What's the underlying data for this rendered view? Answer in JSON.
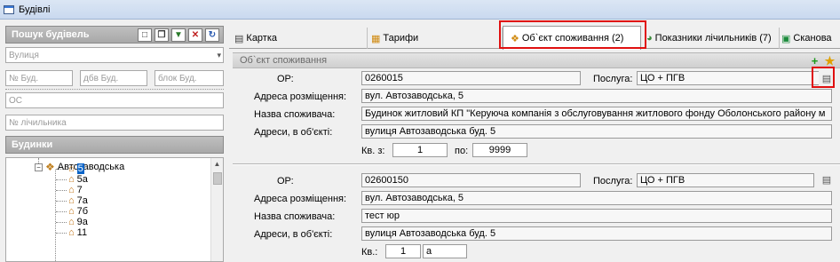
{
  "window": {
    "title": "Будівлі"
  },
  "search": {
    "header": "Пошук будівель",
    "street_placeholder": "Вулиця",
    "building_no_placeholder": "№ Буд.",
    "building_no2_placeholder": "дбв Буд.",
    "block_placeholder": "блок Буд.",
    "os_placeholder": "ОС",
    "meter_placeholder": "№ лічильника"
  },
  "houses": {
    "header": "Будинки",
    "street": "Автозаводська",
    "items": [
      "5",
      "5а",
      "7",
      "7а",
      "7б",
      "9а",
      "11"
    ],
    "selected_index": 0
  },
  "tabs": [
    {
      "label": "Картка"
    },
    {
      "label": "Тарифи"
    },
    {
      "label": "Об`єкт споживання (2)"
    },
    {
      "label": "Показники лічильників (7)"
    },
    {
      "label": "Сканова"
    }
  ],
  "object_section": {
    "header": "Об`єкт споживання",
    "labels": {
      "op": "ОР:",
      "service": "Послуга:",
      "address": "Адреса розміщення:",
      "consumer": "Назва споживача:",
      "obj_addresses": "Адреси, в об'єкті:",
      "apt_from": "Кв. з:",
      "apt_to": "по:",
      "apt": "Кв.:"
    },
    "records": [
      {
        "op": "0260015",
        "service": "ЦО + ПГВ",
        "address": "вул. Автозаводська, 5",
        "consumer": "Будинок житловий КП  \"Керуюча компанія з обслуговування житлового фонду Оболонського району м",
        "obj_addresses": "вулиця Автозаводська буд. 5",
        "apt_from": "1",
        "apt_to": "9999"
      },
      {
        "op": "02600150",
        "service": "ЦО + ПГВ",
        "address": "вул. Автозаводська, 5",
        "consumer": "тест юр",
        "obj_addresses": "вулиця Автозаводська буд. 5",
        "apt": "1",
        "apt_suffix": "а"
      }
    ]
  },
  "colors": {
    "highlight": "#e01010",
    "selection": "#0a64c8",
    "panel_header": "#a8a8a8"
  }
}
